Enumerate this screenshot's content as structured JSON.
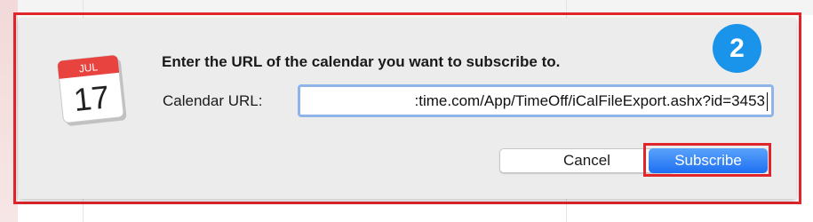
{
  "dialog": {
    "heading": "Enter the URL of the calendar you want to subscribe to.",
    "url_label": "Calendar URL:",
    "url_value": ":time.com/App/TimeOff/iCalFileExport.ashx?id=3453",
    "cancel_label": "Cancel",
    "subscribe_label": "Subscribe"
  },
  "app_icon": {
    "month": "JUL",
    "day": "17"
  },
  "step_badge": {
    "number": "2"
  },
  "colors": {
    "highlight": "#e0262b",
    "badge": "#1a93ea",
    "primary_button": "#1d6ff2",
    "sheet_background": "#ececec"
  }
}
